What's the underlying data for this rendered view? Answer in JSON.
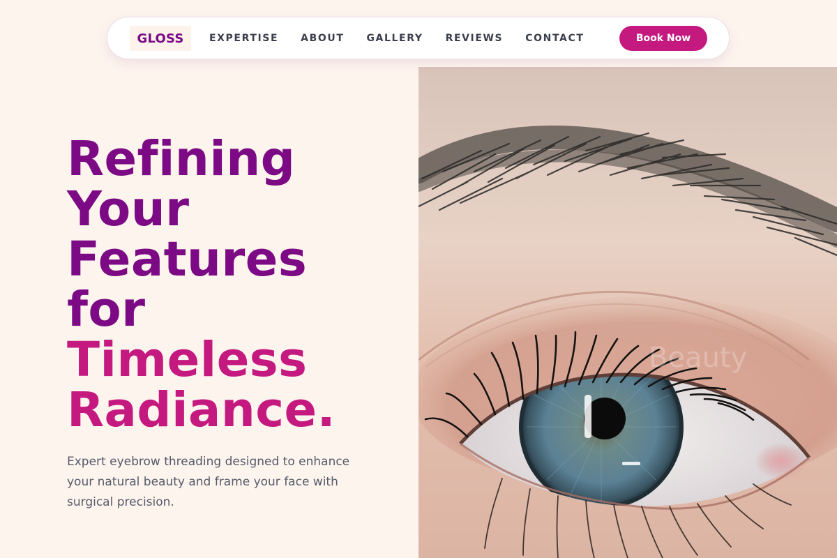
{
  "brand": {
    "name": "GLOSS"
  },
  "nav": {
    "links": [
      "EXPERTISE",
      "ABOUT",
      "GALLERY",
      "REVIEWS",
      "CONTACT"
    ],
    "cta": "Book Now"
  },
  "hero": {
    "title_lines": [
      "Refining",
      "Your",
      "Features",
      "for"
    ],
    "title_highlight_lines": [
      "Timeless",
      "Radiance."
    ],
    "description": "Expert eyebrow threading designed to enhance your natural beauty and frame your face with surgical precision."
  },
  "image": {
    "subject": "close-up-eye-with-eyebrow",
    "watermark_text": "Beauty"
  },
  "colors": {
    "background": "#fef4ee",
    "brand_purple": "#7b0a84",
    "accent_magenta": "#c4197f",
    "nav_text": "#3b3f4c",
    "body_text": "#555b69",
    "iris": "#4d7285"
  }
}
